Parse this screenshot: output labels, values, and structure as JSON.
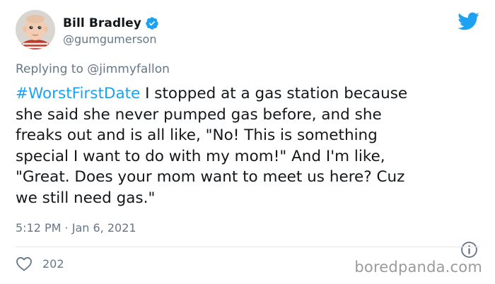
{
  "user": {
    "display_name": "Bill Bradley",
    "handle": "@gumgumerson",
    "verified": true
  },
  "replying": {
    "prefix": "Replying to",
    "mention": "@jimmyfallon"
  },
  "tweet": {
    "hashtag": "#WorstFirstDate",
    "line1_rest": " I stopped at a gas station because",
    "line2": "she said she never pumped gas before, and she",
    "line3": "freaks out and is all like, \"No! This is something",
    "line4": "special I want to do with my mom!\" And I'm like,",
    "line5": "\"Great. Does your mom want to meet us here? Cuz",
    "line6": "we still need gas.\""
  },
  "meta": {
    "timestamp": "5:12 PM · Jan 6, 2021"
  },
  "engagement": {
    "likes": "202"
  },
  "watermark": "boredpanda.com",
  "colors": {
    "twitter_blue": "#1da1f2",
    "text_primary": "#14171a",
    "text_secondary": "#657786",
    "divider": "#e1e8ed",
    "watermark": "#9a9a9a"
  },
  "icons": {
    "brand": "twitter-bird-icon",
    "verified": "verified-badge-icon",
    "info": "info-icon",
    "like": "heart-icon"
  }
}
